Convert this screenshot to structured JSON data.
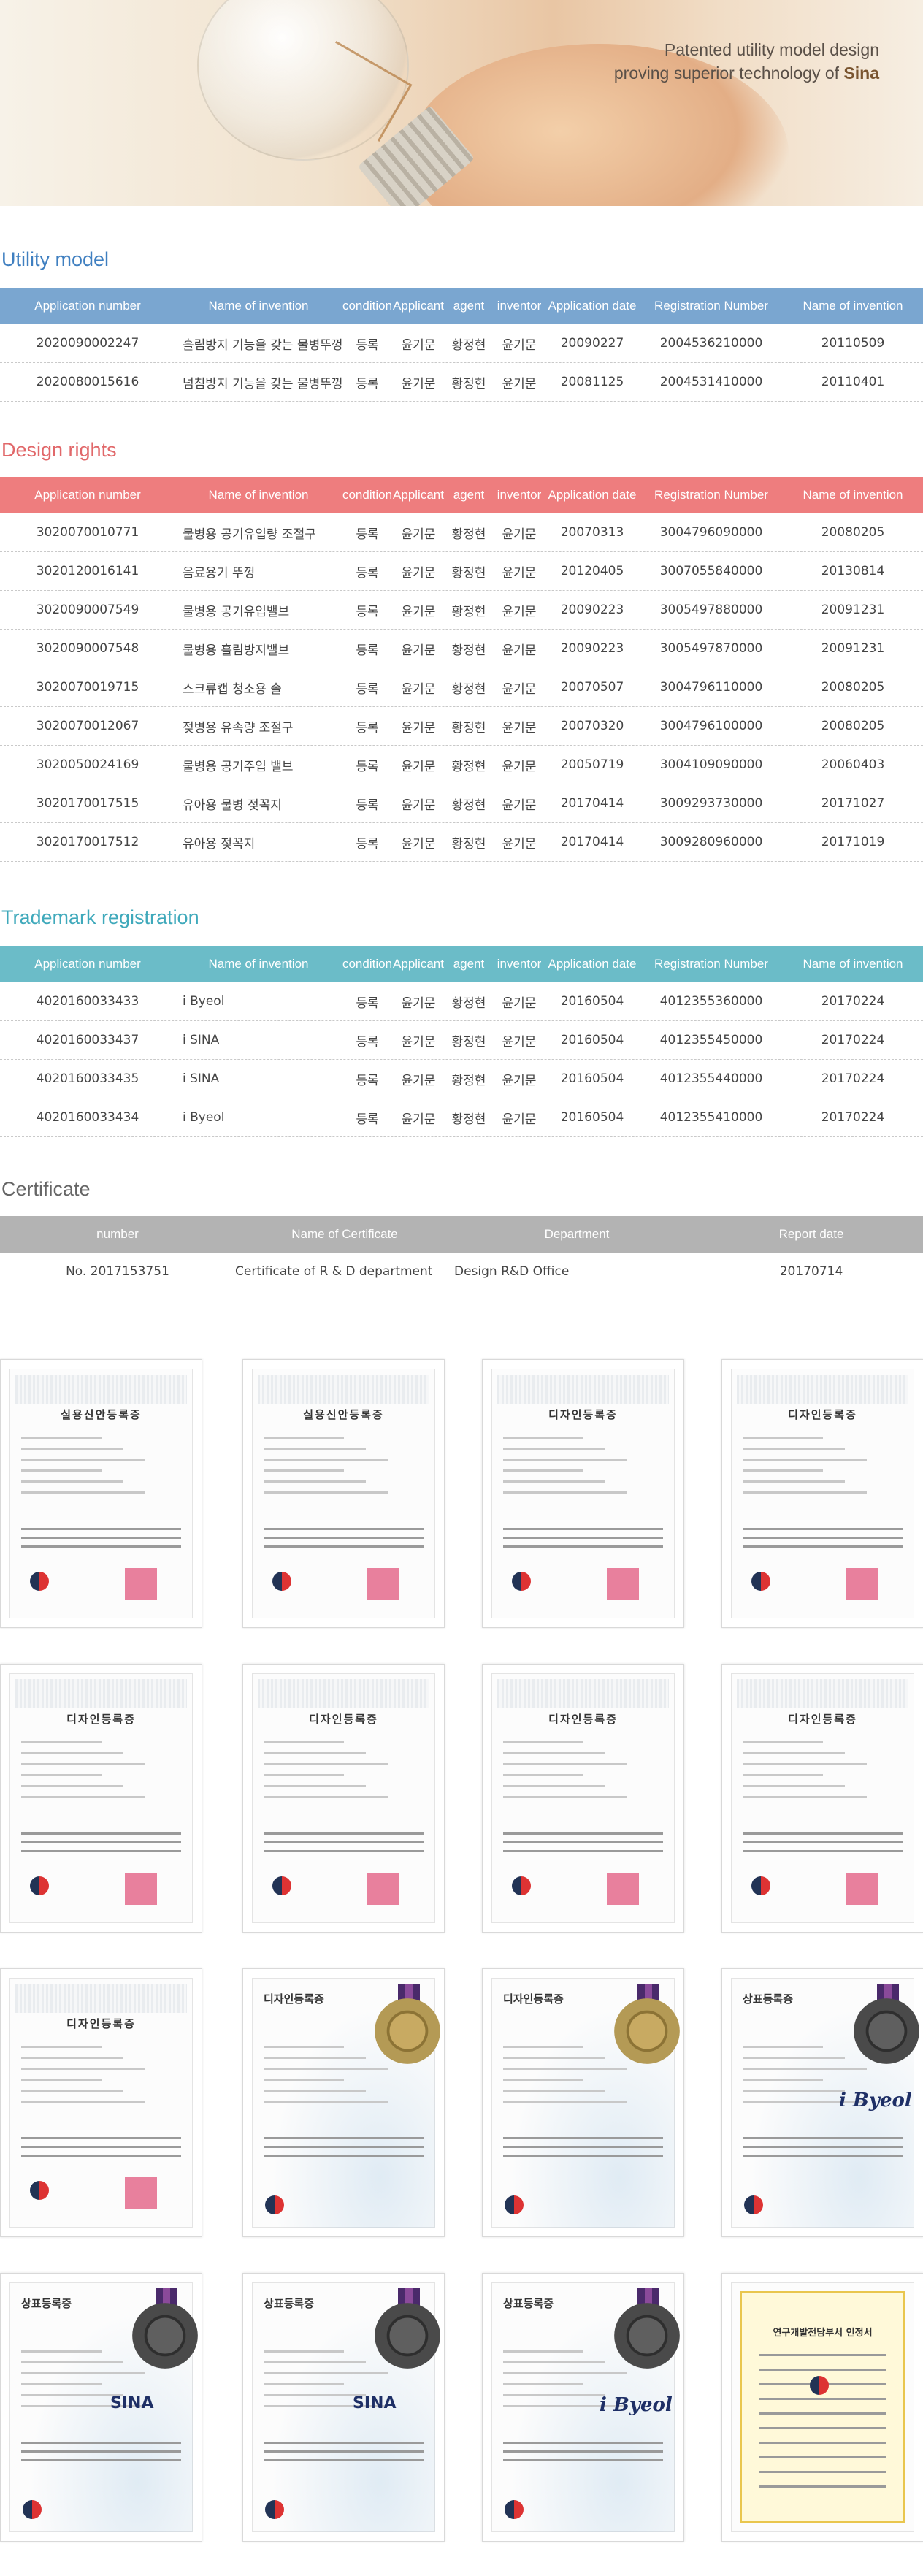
{
  "hero": {
    "line1": "Patented utility model design",
    "line2_prefix": "proving superior technology of ",
    "line2_brand": "Sina"
  },
  "columns": [
    "Application number",
    "Name of invention",
    "condition",
    "Applicant",
    "agent",
    "inventor",
    "Application date",
    "Registration Number",
    "Name of invention"
  ],
  "utility": {
    "title": "Utility model",
    "rows": [
      [
        "2020090002247",
        "흘림방지 기능을 갖는 물병뚜껑",
        "등록",
        "윤기문",
        "황정현",
        "윤기문",
        "20090227",
        "2004536210000",
        "20110509"
      ],
      [
        "2020080015616",
        "넘침방지 기능을 갖는 물병뚜껑",
        "등록",
        "윤기문",
        "황정현",
        "윤기문",
        "20081125",
        "2004531410000",
        "20110401"
      ]
    ]
  },
  "design": {
    "title": "Design rights",
    "rows": [
      [
        "3020070010771",
        "물병용 공기유입량 조절구",
        "등록",
        "윤기문",
        "황정현",
        "윤기문",
        "20070313",
        "3004796090000",
        "20080205"
      ],
      [
        "3020120016141",
        "음료용기 뚜껑",
        "등록",
        "윤기문",
        "황정현",
        "윤기문",
        "20120405",
        "3007055840000",
        "20130814"
      ],
      [
        "3020090007549",
        "물병용 공기유입밸브",
        "등록",
        "윤기문",
        "황정현",
        "윤기문",
        "20090223",
        "3005497880000",
        "20091231"
      ],
      [
        "3020090007548",
        "물병용 흘림방지밸브",
        "등록",
        "윤기문",
        "황정현",
        "윤기문",
        "20090223",
        "3005497870000",
        "20091231"
      ],
      [
        "3020070019715",
        "스크류캡 청소용 솔",
        "등록",
        "윤기문",
        "황정현",
        "윤기문",
        "20070507",
        "3004796110000",
        "20080205"
      ],
      [
        "3020070012067",
        "젖병용 유속량 조절구",
        "등록",
        "윤기문",
        "황정현",
        "윤기문",
        "20070320",
        "3004796100000",
        "20080205"
      ],
      [
        "3020050024169",
        "물병용 공기주입 밸브",
        "등록",
        "윤기문",
        "황정현",
        "윤기문",
        "20050719",
        "3004109090000",
        "20060403"
      ],
      [
        "3020170017515",
        "유아용 물병 젖꼭지",
        "등록",
        "윤기문",
        "황정현",
        "윤기문",
        "20170414",
        "3009293730000",
        "20171027"
      ],
      [
        "3020170017512",
        "유아용 젖꼭지",
        "등록",
        "윤기문",
        "황정현",
        "윤기문",
        "20170414",
        "3009280960000",
        "20171019"
      ]
    ]
  },
  "trademark": {
    "title": "Trademark registration",
    "rows": [
      [
        "4020160033433",
        "i Byeol",
        "등록",
        "윤기문",
        "황정현",
        "윤기문",
        "20160504",
        "4012355360000",
        "20170224"
      ],
      [
        "4020160033437",
        "i SINA",
        "등록",
        "윤기문",
        "황정현",
        "윤기문",
        "20160504",
        "4012355450000",
        "20170224"
      ],
      [
        "4020160033435",
        "i SINA",
        "등록",
        "윤기문",
        "황정현",
        "윤기문",
        "20160504",
        "4012355440000",
        "20170224"
      ],
      [
        "4020160033434",
        "i Byeol",
        "등록",
        "윤기문",
        "황정현",
        "윤기문",
        "20160504",
        "4012355410000",
        "20170224"
      ]
    ]
  },
  "certificate": {
    "title": "Certificate",
    "columns": [
      "number",
      "Name of Certificate",
      "Department",
      "Report date"
    ],
    "rows": [
      [
        "No. 2017153751",
        "Certificate of R & D department",
        "Design R&D Office",
        "20170714"
      ]
    ]
  },
  "cert_images": [
    {
      "title": "실용신안등록증",
      "kind": "patent"
    },
    {
      "title": "실용신안등록증",
      "kind": "patent"
    },
    {
      "title": "디자인등록증",
      "kind": "patent"
    },
    {
      "title": "디자인등록증",
      "kind": "patent"
    },
    {
      "title": "디자인등록증",
      "kind": "patent"
    },
    {
      "title": "디자인등록증",
      "kind": "patent"
    },
    {
      "title": "디자인등록증",
      "kind": "patent"
    },
    {
      "title": "디자인등록증",
      "kind": "patent"
    },
    {
      "title": "디자인등록증",
      "kind": "patent"
    },
    {
      "title": "디자인등록증",
      "kind": "seal-gold"
    },
    {
      "title": "디자인등록증",
      "kind": "seal-gold"
    },
    {
      "title": "상표등록증",
      "kind": "seal-dark",
      "logo": "i Byeol"
    },
    {
      "title": "상표등록증",
      "kind": "seal-dark",
      "logo": "SINA"
    },
    {
      "title": "상표등록증",
      "kind": "seal-dark",
      "logo": "SINA"
    },
    {
      "title": "상표등록증",
      "kind": "seal-dark",
      "logo": "i Byeol"
    },
    {
      "title": "연구개발전담부서 인정서",
      "kind": "gold-frame"
    }
  ],
  "colors": {
    "utility": "#7aa6d0",
    "design": "#ee7d7e",
    "trademark": "#6bbcc8",
    "certificate": "#b3b3b3"
  }
}
